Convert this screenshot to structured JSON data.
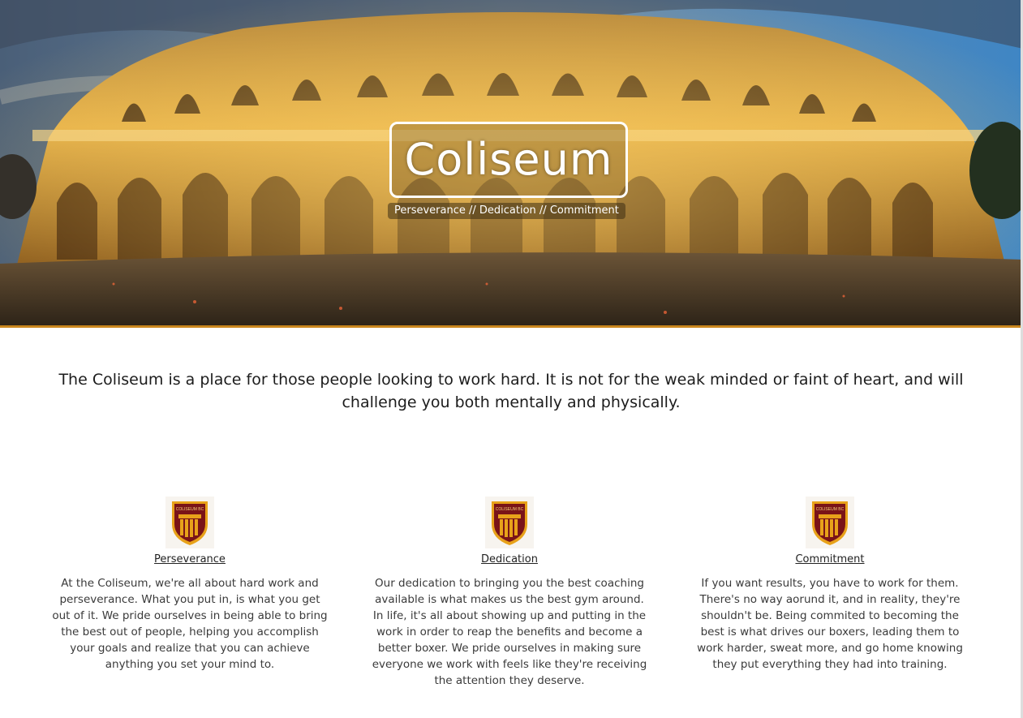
{
  "hero": {
    "title": "Coliseum",
    "tagline": "Perseverance // Dedication // Commitment"
  },
  "intro": {
    "text": "The Coliseum is a place for those people looking to work hard. It is not for the weak minded or faint of heart, and will challenge you both mentally and physically."
  },
  "features": [
    {
      "crest_text": "COLISEUM BC",
      "title": "Perseverance",
      "text": "At the Coliseum, we're all about hard work and perseverance. What you put in, is what you get out of it. We pride ourselves in being able to bring the best out of people, helping you accomplish your goals and realize that you can achieve anything you set your mind to."
    },
    {
      "crest_text": "COLISEUM BC",
      "title": "Dedication",
      "text": "Our dedication to bringing you the best coaching available is what makes us the best gym around. In life, it's all about showing up and putting in the work in order to reap the benefits and become a better boxer. We pride ourselves in making sure everyone we work with feels like they're receiving the attention they deserve."
    },
    {
      "crest_text": "COLISEUM BC",
      "title": "Commitment",
      "text": "If you want results, you have to work for them. There's no way aorund it, and in reality, they're shouldn't be. Being commited to becoming the best is what drives our boxers, leading them to work harder, sweat more, and go home knowing they put everything they had into training."
    }
  ],
  "colors": {
    "accent": "#c9861e",
    "crest_shield": "#7a1418",
    "crest_gold": "#e8a21a"
  }
}
